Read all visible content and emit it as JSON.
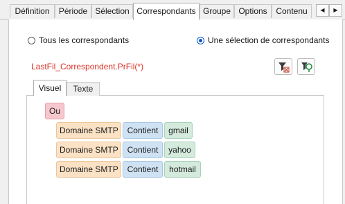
{
  "tabs": [
    {
      "label": "Définition",
      "active": false
    },
    {
      "label": "Période",
      "active": false
    },
    {
      "label": "Sélection",
      "active": false
    },
    {
      "label": "Correspondants",
      "active": true
    },
    {
      "label": "Groupe",
      "active": false
    },
    {
      "label": "Options",
      "active": false
    },
    {
      "label": "Contenu",
      "active": false
    }
  ],
  "scroll": {
    "left_icon": "triangle-left-icon",
    "right_icon": "triangle-right-icon",
    "left_glyph": "◀",
    "right_glyph": "▶"
  },
  "radios": [
    {
      "label": "Tous les correspondants",
      "checked": false
    },
    {
      "label": "Une sélection de correspondants",
      "checked": true
    }
  ],
  "formula": "LastFil_Correspondent.PrFil(*)",
  "toolbar": {
    "clear_filter_icon": "clear-filter-icon",
    "edit_filter_icon": "filter-edit-icon"
  },
  "inner_tabs": [
    {
      "label": "Visuel",
      "active": true
    },
    {
      "label": "Texte",
      "active": false
    }
  ],
  "condition": {
    "operator": "Ou",
    "rows": [
      {
        "field": "Domaine SMTP",
        "comparator": "Contient",
        "value": "gmail"
      },
      {
        "field": "Domaine SMTP",
        "comparator": "Contient",
        "value": "yahoo"
      },
      {
        "field": "Domaine SMTP",
        "comparator": "Contient",
        "value": "hotmail"
      }
    ]
  },
  "colors": {
    "accent": "#0a57c8",
    "formula": "#d93025",
    "op_chip": "#f6c7cc",
    "field_chip": "#fbe2c5",
    "cmp_chip": "#cfe2f3",
    "val_chip": "#d4eadd"
  }
}
